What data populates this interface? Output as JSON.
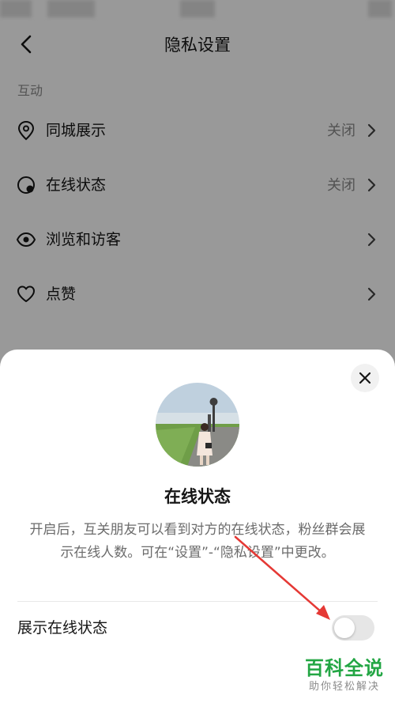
{
  "header": {
    "title": "隐私设置"
  },
  "section": {
    "title": "互动"
  },
  "rows": [
    {
      "label": "同城展示",
      "value": "关闭",
      "icon": "location-pin-icon"
    },
    {
      "label": "在线状态",
      "value": "关闭",
      "icon": "online-status-icon"
    },
    {
      "label": "浏览和访客",
      "value": "",
      "icon": "eye-icon"
    },
    {
      "label": "点赞",
      "value": "",
      "icon": "heart-icon"
    }
  ],
  "sheet": {
    "title": "在线状态",
    "description": "开启后，互关朋友可以看到对方的在线状态，粉丝群会展示在线人数。可在“设置”-“隐私设置”中更改。",
    "toggle_label": "展示在线状态",
    "toggle_on": false
  },
  "watermark": {
    "title": "百科全说",
    "subtitle": "助你轻松解决"
  },
  "colors": {
    "arrow": "#e53935",
    "watermark": "#23a644"
  }
}
